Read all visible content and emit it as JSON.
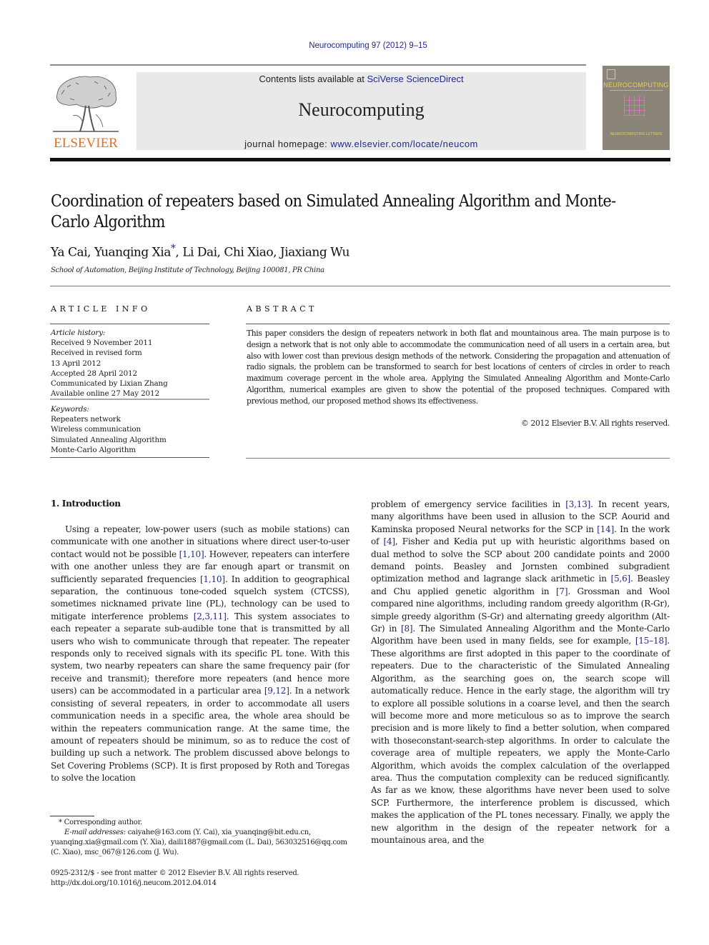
{
  "header": {
    "journal_ref": "Neurocomputing 97 (2012) 9–15",
    "contents_prefix": "Contents lists available at ",
    "contents_link": "SciVerse ScienceDirect",
    "journal_name": "Neurocomputing",
    "homepage_prefix": "journal homepage: ",
    "homepage_link": "www.elsevier.com/locate/neucom",
    "publisher_logo": "ELSEVIER",
    "cover": {
      "title": "NEUROCOMPUTING",
      "bottom_text": "NEUROCOMPUTING LETTERS",
      "bg_color": "#8b8478",
      "title_color": "#e8d24a"
    },
    "colors": {
      "link": "#1f2a8a",
      "elsevier_orange": "#e46f1f",
      "masthead_bg": "#e9e9e9"
    }
  },
  "article": {
    "title": "Coordination of repeaters based on Simulated Annealing Algorithm and Monte-Carlo Algorithm",
    "authors": "Ya Cai, Yuanqing Xia",
    "authors_mark": "*",
    "authors_rest": ", Li Dai, Chi Xiao, Jiaxiang Wu",
    "affiliation": "School of Automation, Beijing Institute of Technology, Beijing 100081, PR China"
  },
  "article_info": {
    "heading": "ARTICLE INFO",
    "history_label": "Article history:",
    "history": [
      "Received 9 November 2011",
      "Received in revised form",
      "13 April 2012",
      "Accepted 28 April 2012",
      "Communicated by Lixian Zhang",
      "Available online 27 May 2012"
    ],
    "keywords_label": "Keywords:",
    "keywords": [
      "Repeaters network",
      "Wireless communication",
      "Simulated Annealing Algorithm",
      "Monte-Carlo Algorithm"
    ]
  },
  "abstract": {
    "heading": "ABSTRACT",
    "text": "This paper considers the design of repeaters network in both flat and mountainous area. The main purpose is to design a network that is not only able to accommodate the communication need of all users in a certain area, but also with lower cost than previous design methods of the network. Considering the propagation and attenuation of radio signals, the problem can be transformed to search for best locations of centers of circles in order to reach maximum coverage percent in the whole area. Applying the Simulated Annealing Algorithm and Monte-Carlo Algorithm, numerical examples are given to show the potential of the proposed techniques. Compared with previous method, our proposed method shows its effectiveness.",
    "copyright": "© 2012 Elsevier B.V. All rights reserved."
  },
  "body": {
    "section_heading": "1.  Introduction",
    "left": [
      {
        "t": "Using a repeater, low-power users (such as mobile stations) can communicate with one another in situations where direct user-to-user contact would not be possible "
      },
      {
        "c": "[1,10]"
      },
      {
        "t": ". However, repeaters can interfere with one another unless they are far enough apart or transmit on sufficiently separated frequencies "
      },
      {
        "c": "[1,10]"
      },
      {
        "t": ". In addition to geographical separation, the continuous tone-coded squelch system (CTCSS), sometimes nicknamed private line (PL), technology can be used to mitigate interference problems "
      },
      {
        "c": "[2,3,11]"
      },
      {
        "t": ". This system associates to each repeater a separate sub-audible tone that is transmitted by all users who wish to communicate through that repeater. The repeater responds only to received signals with its specific PL tone. With this system, two nearby repeaters can share the same frequency pair (for receive and transmit); therefore more repeaters (and hence more users) can be accommodated in a particular area "
      },
      {
        "c": "[9,12]"
      },
      {
        "t": ". In a network consisting of several repeaters, in order to accommodate all users communication needs in a specific area, the whole area should be within the repeaters communication range. At the same time, the amount of repeaters should be minimum, so as to reduce the cost of building up such a network. The problem discussed above belongs to Set Covering Problems (SCP). It is first proposed by Roth and Toregas to solve the location"
      }
    ],
    "right": [
      {
        "t": "problem of emergency service facilities in "
      },
      {
        "c": "[3,13]"
      },
      {
        "t": ". In recent years, many algorithms have been used in allusion to the SCP. Aourid and Kaminska proposed Neural networks for the SCP in "
      },
      {
        "c": "[14]"
      },
      {
        "t": ". In the work of "
      },
      {
        "c": "[4]"
      },
      {
        "t": ", Fisher and Kedia put up with heuristic algorithms based on dual method to solve the SCP about 200 candidate points and 2000 demand points. Beasley and Jornsten combined subgradient optimization method and lagrange slack arithmetic in "
      },
      {
        "c": "[5,6]"
      },
      {
        "t": ". Beasley and Chu applied genetic algorithm in "
      },
      {
        "c": "[7]"
      },
      {
        "t": ". Grossman and Wool compared nine algorithms, including random greedy algorithm (R-Gr), simple greedy algorithm (S-Gr) and alternating greedy algorithm (Alt-Gr) in "
      },
      {
        "c": "[8]"
      },
      {
        "t": ". The Simulated Annealing Algorithm and the Monte-Carlo Algorithm have been used in many fields, see for example, "
      },
      {
        "c": "[15–18]"
      },
      {
        "t": ". These algorithms are first adopted in this paper to the coordinate of repeaters. Due to the characteristic of the Simulated Annealing Algorithm, as the searching goes on, the search scope will automatically reduce. Hence in the early stage, the algorithm will try to explore all possible solutions in a coarse level, and then the search will become more and more meticulous so as to improve the search precision and is more likely to find a better solution, when compared with thoseconstant-search-step algorithms. In order to calculate the coverage area of multiple repeaters, we apply the Monte-Carlo Algorithm, which avoids the complex calculation of the overlapped area. Thus the computation complexity can be reduced significantly. As far as we know, these algorithms have never been used to solve SCP. Furthermore, the interference problem is discussed, which makes the application of the PL tones necessary. Finally, we apply the new algorithm in the design of the repeater network for a mountainous area, and the"
      }
    ]
  },
  "footnotes": {
    "corresponding": "* Corresponding author.",
    "email_label": "E-mail addresses:",
    "emails": " caiyahe@163.com (Y. Cai), xia_yuanqing@bit.edu.cn, yuanqing.xia@gmail.com (Y. Xia), daili1887@gmail.com (L. Dai), 563032516@qq.com (C. Xiao), msc_067@126.com (J. Wu).",
    "front_matter": "0925-2312/$ - see front matter © 2012 Elsevier B.V. All rights reserved.",
    "doi": "http://dx.doi.org/10.1016/j.neucom.2012.04.014"
  }
}
